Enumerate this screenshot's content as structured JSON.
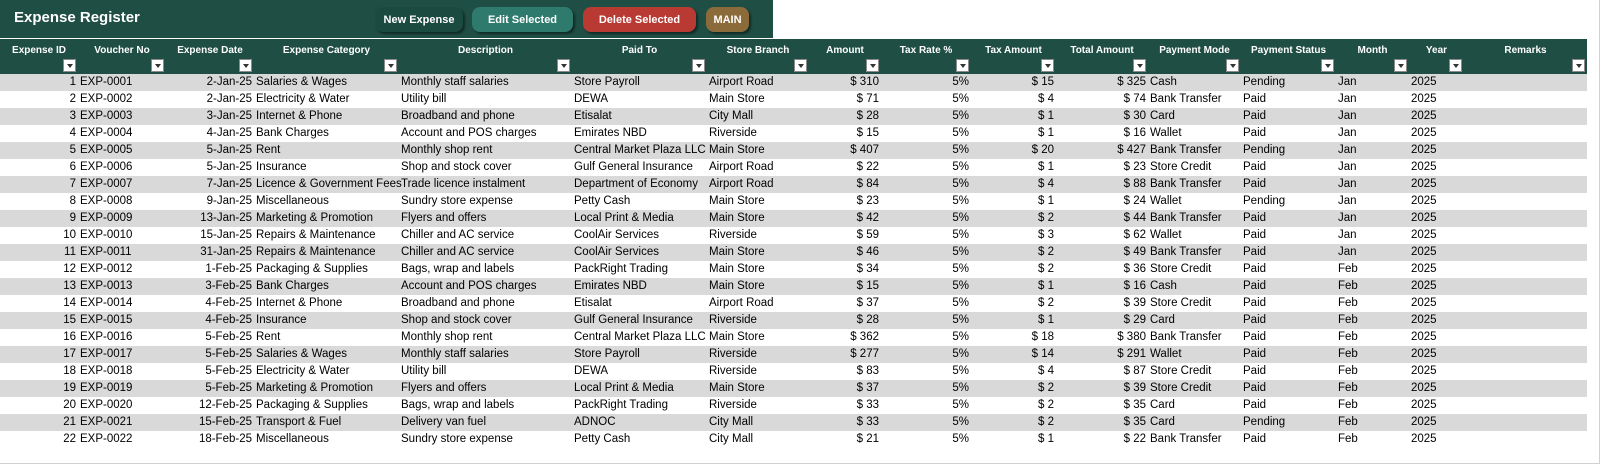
{
  "app": {
    "title": "Expense Register"
  },
  "toolbar": {
    "new_label": "New Expense",
    "edit_label": "Edit Selected",
    "delete_label": "Delete Selected",
    "main_label": "MAIN"
  },
  "colors": {
    "header_bg": "#1f4e44",
    "edit_btn": "#2e7b6e",
    "delete_btn": "#b83a33",
    "main_btn": "#8b6b3a",
    "band": "#d9d9d9"
  },
  "table": {
    "columns": [
      "Expense ID",
      "Voucher No",
      "Expense Date",
      "Expense Category",
      "Description",
      "Paid To",
      "Store Branch",
      "Amount",
      "Tax Rate %",
      "Tax Amount",
      "Total Amount",
      "Payment Mode",
      "Payment Status",
      "Month",
      "Year",
      "Remarks"
    ],
    "rows": [
      [
        "1",
        "EXP-0001",
        "2-Jan-25",
        "Salaries & Wages",
        "Monthly staff salaries",
        "Store Payroll",
        "Airport Road",
        "$ 310",
        "5%",
        "$ 15",
        "$ 325",
        "Cash",
        "Pending",
        "Jan",
        "2025",
        ""
      ],
      [
        "2",
        "EXP-0002",
        "2-Jan-25",
        "Electricity & Water",
        "Utility bill",
        "DEWA",
        "Main Store",
        "$ 71",
        "5%",
        "$ 4",
        "$ 74",
        "Bank Transfer",
        "Paid",
        "Jan",
        "2025",
        ""
      ],
      [
        "3",
        "EXP-0003",
        "3-Jan-25",
        "Internet & Phone",
        "Broadband and phone",
        "Etisalat",
        "City Mall",
        "$ 28",
        "5%",
        "$ 1",
        "$ 30",
        "Card",
        "Paid",
        "Jan",
        "2025",
        ""
      ],
      [
        "4",
        "EXP-0004",
        "4-Jan-25",
        "Bank Charges",
        "Account and POS charges",
        "Emirates NBD",
        "Riverside",
        "$ 15",
        "5%",
        "$ 1",
        "$ 16",
        "Wallet",
        "Paid",
        "Jan",
        "2025",
        ""
      ],
      [
        "5",
        "EXP-0005",
        "5-Jan-25",
        "Rent",
        "Monthly shop rent",
        "Central Market Plaza LLC",
        "Main Store",
        "$ 407",
        "5%",
        "$ 20",
        "$ 427",
        "Bank Transfer",
        "Pending",
        "Jan",
        "2025",
        ""
      ],
      [
        "6",
        "EXP-0006",
        "5-Jan-25",
        "Insurance",
        "Shop and stock cover",
        "Gulf General Insurance",
        "Airport Road",
        "$ 22",
        "5%",
        "$ 1",
        "$ 23",
        "Store Credit",
        "Paid",
        "Jan",
        "2025",
        ""
      ],
      [
        "7",
        "EXP-0007",
        "7-Jan-25",
        "Licence & Government Fees",
        "Trade licence instalment",
        "Department of Economy",
        "Airport Road",
        "$ 84",
        "5%",
        "$ 4",
        "$ 88",
        "Bank Transfer",
        "Paid",
        "Jan",
        "2025",
        ""
      ],
      [
        "8",
        "EXP-0008",
        "9-Jan-25",
        "Miscellaneous",
        "Sundry store expense",
        "Petty Cash",
        "Main Store",
        "$ 23",
        "5%",
        "$ 1",
        "$ 24",
        "Wallet",
        "Pending",
        "Jan",
        "2025",
        ""
      ],
      [
        "9",
        "EXP-0009",
        "13-Jan-25",
        "Marketing & Promotion",
        "Flyers and offers",
        "Local Print & Media",
        "Main Store",
        "$ 42",
        "5%",
        "$ 2",
        "$ 44",
        "Bank Transfer",
        "Paid",
        "Jan",
        "2025",
        ""
      ],
      [
        "10",
        "EXP-0010",
        "15-Jan-25",
        "Repairs & Maintenance",
        "Chiller and AC service",
        "CoolAir Services",
        "Riverside",
        "$ 59",
        "5%",
        "$ 3",
        "$ 62",
        "Wallet",
        "Paid",
        "Jan",
        "2025",
        ""
      ],
      [
        "11",
        "EXP-0011",
        "31-Jan-25",
        "Repairs & Maintenance",
        "Chiller and AC service",
        "CoolAir Services",
        "Main Store",
        "$ 46",
        "5%",
        "$ 2",
        "$ 49",
        "Bank Transfer",
        "Paid",
        "Jan",
        "2025",
        ""
      ],
      [
        "12",
        "EXP-0012",
        "1-Feb-25",
        "Packaging & Supplies",
        "Bags, wrap and labels",
        "PackRight Trading",
        "Main Store",
        "$ 34",
        "5%",
        "$ 2",
        "$ 36",
        "Store Credit",
        "Paid",
        "Feb",
        "2025",
        ""
      ],
      [
        "13",
        "EXP-0013",
        "3-Feb-25",
        "Bank Charges",
        "Account and POS charges",
        "Emirates NBD",
        "Main Store",
        "$ 15",
        "5%",
        "$ 1",
        "$ 16",
        "Cash",
        "Paid",
        "Feb",
        "2025",
        ""
      ],
      [
        "14",
        "EXP-0014",
        "4-Feb-25",
        "Internet & Phone",
        "Broadband and phone",
        "Etisalat",
        "Airport Road",
        "$ 37",
        "5%",
        "$ 2",
        "$ 39",
        "Store Credit",
        "Paid",
        "Feb",
        "2025",
        ""
      ],
      [
        "15",
        "EXP-0015",
        "4-Feb-25",
        "Insurance",
        "Shop and stock cover",
        "Gulf General Insurance",
        "Riverside",
        "$ 28",
        "5%",
        "$ 1",
        "$ 29",
        "Card",
        "Paid",
        "Feb",
        "2025",
        ""
      ],
      [
        "16",
        "EXP-0016",
        "5-Feb-25",
        "Rent",
        "Monthly shop rent",
        "Central Market Plaza LLC",
        "Main Store",
        "$ 362",
        "5%",
        "$ 18",
        "$ 380",
        "Bank Transfer",
        "Paid",
        "Feb",
        "2025",
        ""
      ],
      [
        "17",
        "EXP-0017",
        "5-Feb-25",
        "Salaries & Wages",
        "Monthly staff salaries",
        "Store Payroll",
        "Riverside",
        "$ 277",
        "5%",
        "$ 14",
        "$ 291",
        "Wallet",
        "Paid",
        "Feb",
        "2025",
        ""
      ],
      [
        "18",
        "EXP-0018",
        "5-Feb-25",
        "Electricity & Water",
        "Utility bill",
        "DEWA",
        "Riverside",
        "$ 83",
        "5%",
        "$ 4",
        "$ 87",
        "Store Credit",
        "Paid",
        "Feb",
        "2025",
        ""
      ],
      [
        "19",
        "EXP-0019",
        "5-Feb-25",
        "Marketing & Promotion",
        "Flyers and offers",
        "Local Print & Media",
        "Main Store",
        "$ 37",
        "5%",
        "$ 2",
        "$ 39",
        "Store Credit",
        "Paid",
        "Feb",
        "2025",
        ""
      ],
      [
        "20",
        "EXP-0020",
        "12-Feb-25",
        "Packaging & Supplies",
        "Bags, wrap and labels",
        "PackRight Trading",
        "Riverside",
        "$ 33",
        "5%",
        "$ 2",
        "$ 35",
        "Card",
        "Paid",
        "Feb",
        "2025",
        ""
      ],
      [
        "21",
        "EXP-0021",
        "15-Feb-25",
        "Transport & Fuel",
        "Delivery van fuel",
        "ADNOC",
        "City Mall",
        "$ 33",
        "5%",
        "$ 2",
        "$ 35",
        "Card",
        "Pending",
        "Feb",
        "2025",
        ""
      ],
      [
        "22",
        "EXP-0022",
        "18-Feb-25",
        "Miscellaneous",
        "Sundry store expense",
        "Petty Cash",
        "City Mall",
        "$ 21",
        "5%",
        "$ 1",
        "$ 22",
        "Bank Transfer",
        "Paid",
        "Feb",
        "2025",
        ""
      ]
    ]
  }
}
